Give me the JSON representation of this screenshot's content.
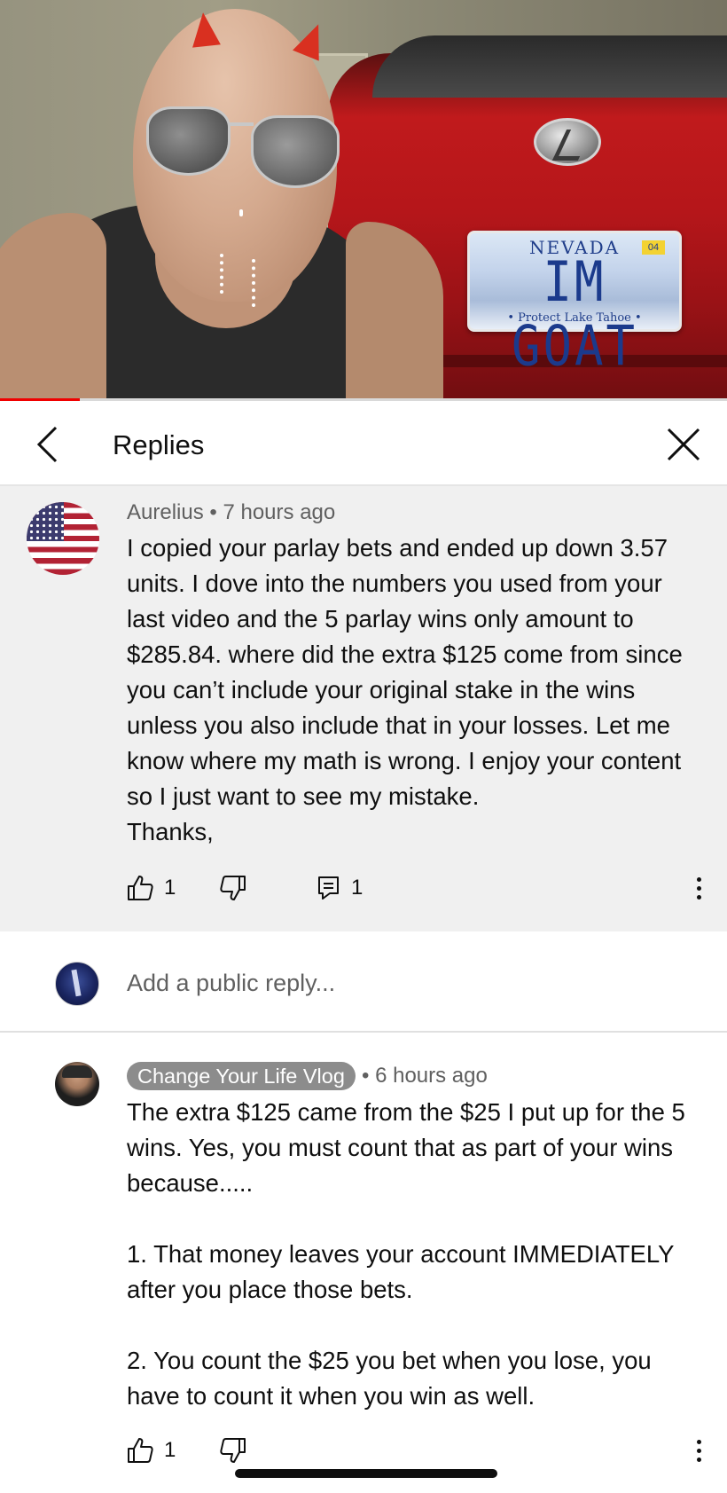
{
  "video": {
    "plate_state": "NEVADA",
    "plate_text": "IM GOAT",
    "plate_sub": "• Protect Lake Tahoe •",
    "plate_sticker": "04",
    "progress_fraction": 0.11,
    "progress_color": "#f00000"
  },
  "header": {
    "title": "Replies",
    "back_icon": "chevron-left-icon",
    "close_icon": "close-icon"
  },
  "parent_comment": {
    "author": "Aurelius",
    "time": "7 hours ago",
    "text": "I copied your parlay bets and ended up down 3.57 units. I dove into the numbers you used from your last video and the 5 parlay wins only amount to $285.84. where did the extra $125 come from since you can’t include your original stake in the wins unless you also include that in your losses. Let me know where my math is wrong. I enjoy your content so I just want to see my mistake.\nThanks,",
    "likes": "1",
    "replies": "1",
    "avatar_icon": "us-flag-avatar"
  },
  "reply_box": {
    "placeholder": "Add a public reply..."
  },
  "reply": {
    "author": "Change Your Life Vlog",
    "time": "6 hours ago",
    "text": "The extra $125 came from the $25 I put up for the 5 wins. Yes, you must count that as part of your wins because.....\n\n1. That money leaves your account IMMEDIATELY after you place those bets.\n\n2. You count the $25 you bet when you lose, you have to count it when you win as well.",
    "likes": "1"
  },
  "colors": {
    "comment_bg": "#f0f0f0",
    "badge_bg": "#8c8c8c",
    "meta_text": "#606060"
  }
}
